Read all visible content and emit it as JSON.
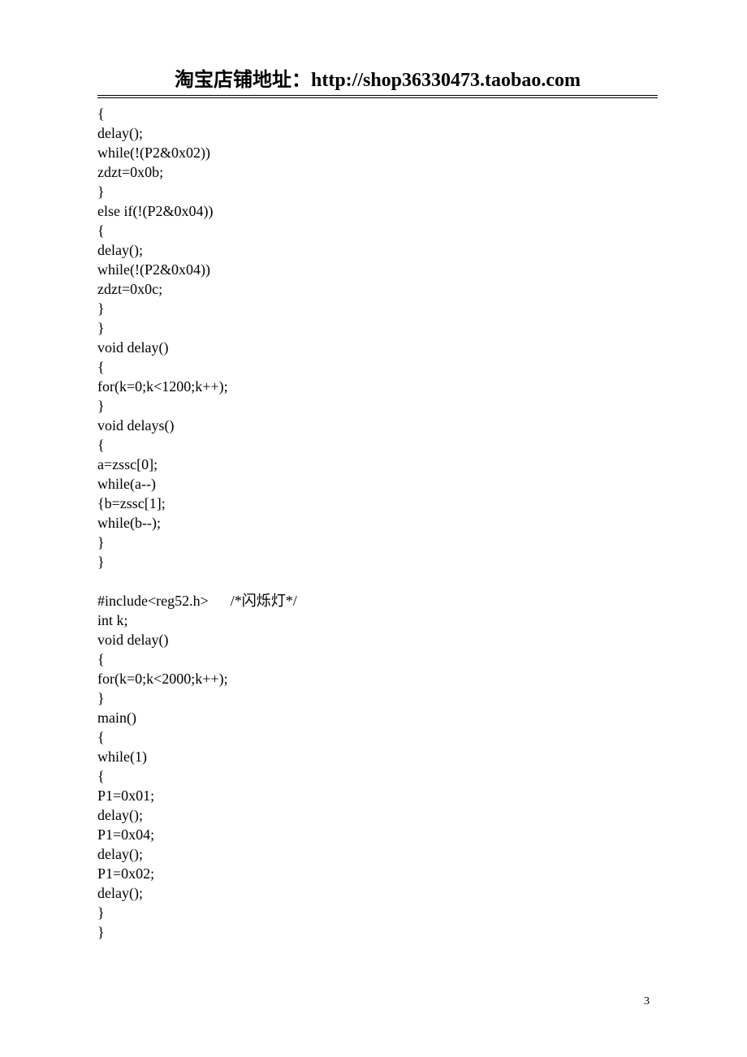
{
  "header": {
    "prefix": "淘宝店铺地址：",
    "url": "http://shop36330473.taobao.com"
  },
  "code": {
    "lines": [
      "{",
      "delay();",
      "while(!(P2&0x02))",
      "zdzt=0x0b;",
      "}",
      "else if(!(P2&0x04))",
      "{",
      "delay();",
      "while(!(P2&0x04))",
      "zdzt=0x0c;",
      "}",
      "}",
      "void delay()",
      "{",
      "for(k=0;k<1200;k++);",
      "}",
      "void delays()",
      "{",
      "a=zssc[0];",
      "while(a--)",
      "{b=zssc[1];",
      "while(b--);",
      "}",
      "}",
      "",
      "#include<reg52.h>      /*闪烁灯*/",
      "int k;",
      "void delay()",
      "{",
      "for(k=0;k<2000;k++);",
      "}",
      "main()",
      "{",
      "while(1)",
      "{",
      "P1=0x01;",
      "delay();",
      "P1=0x04;",
      "delay();",
      "P1=0x02;",
      "delay();",
      "}",
      "}"
    ]
  },
  "page_number": "3"
}
